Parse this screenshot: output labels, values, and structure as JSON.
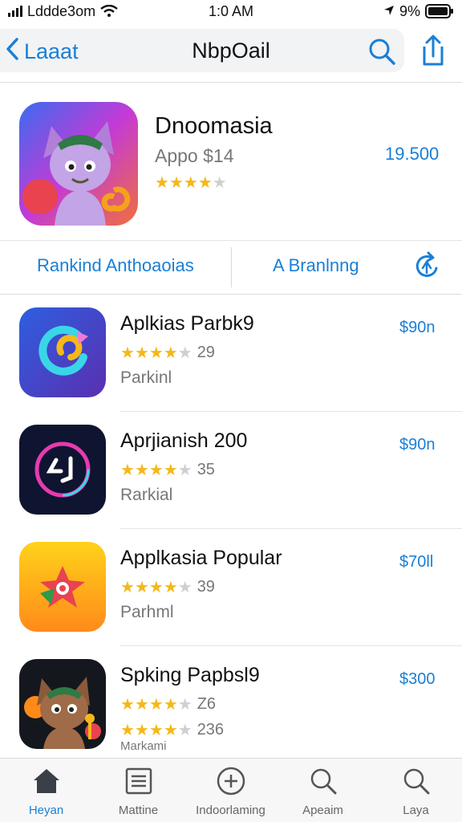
{
  "status": {
    "carrier": "Lddde3om",
    "time": "1:0 AM",
    "battery_pct": "9%"
  },
  "nav": {
    "back_label": "Laaat",
    "title": "NbpOail"
  },
  "featured": {
    "name": "Dnoomasia",
    "subtitle": "Appo $14",
    "price": "19.500",
    "rating": 4,
    "action_left": "Rankind Anthoaoias",
    "action_right": "A Branlnng"
  },
  "apps": [
    {
      "name": "Aplkias Parbk9",
      "rating_count": "29",
      "subtitle": "Parkinl",
      "price": "$90n"
    },
    {
      "name": "Aprjianish 200",
      "rating_count": "35",
      "subtitle": "Rarkial",
      "price": "$90n"
    },
    {
      "name": "Applkasia Popular",
      "rating_count": "39",
      "subtitle": "Parhml",
      "price": "$70ll"
    },
    {
      "name": "Spking Papbsl9",
      "rating_count": "Z6",
      "subtitle": "236",
      "subtitle_cut": "Markami",
      "price": "$300"
    }
  ],
  "tabs": [
    {
      "label": "Heyan",
      "icon": "home-icon"
    },
    {
      "label": "Mattine",
      "icon": "list-icon"
    },
    {
      "label": "Indoorlaming",
      "icon": "plus-circle-icon"
    },
    {
      "label": "Apeaim",
      "icon": "search-icon"
    },
    {
      "label": "Laya",
      "icon": "search-icon"
    }
  ],
  "colors": {
    "accent": "#1a7fd6",
    "star": "#f5b81a"
  }
}
